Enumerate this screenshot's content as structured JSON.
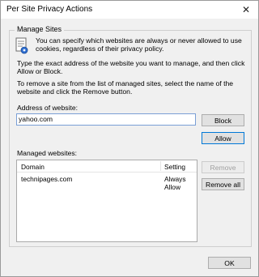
{
  "window": {
    "title": "Per Site Privacy Actions",
    "close_glyph": "✕"
  },
  "group": {
    "label": "Manage Sites",
    "intro": "You can specify which websites are always or never allowed to use cookies, regardless of their privacy policy.",
    "hint1": "Type the exact address of the website you want to manage, and then click Allow or Block.",
    "hint2": "To remove a site from the list of managed sites, select the name of the website and click the Remove button."
  },
  "address": {
    "label": "Address of website:",
    "value": "yahoo.com"
  },
  "buttons": {
    "block": "Block",
    "allow": "Allow",
    "remove": "Remove",
    "remove_all": "Remove all",
    "ok": "OK"
  },
  "managed": {
    "label": "Managed websites:",
    "columns": [
      "Domain",
      "Setting"
    ],
    "rows": [
      {
        "domain": "technipages.com",
        "setting": "Always Allow"
      }
    ]
  },
  "icons": {
    "intro": "cookie-privacy-icon",
    "close": "close-icon"
  }
}
